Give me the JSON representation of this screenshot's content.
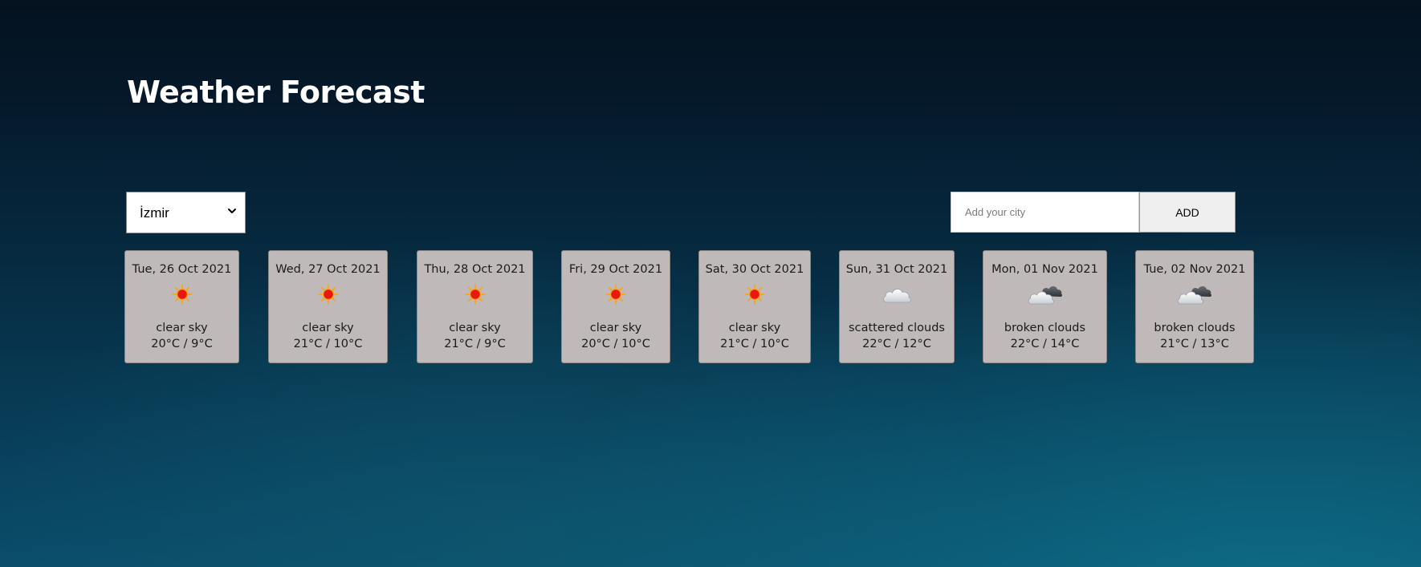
{
  "page": {
    "title": "Weather Forecast"
  },
  "city_select": {
    "selected": "İzmir",
    "icon": "chevron-down-icon"
  },
  "city_input": {
    "value": "",
    "placeholder": "Add your city"
  },
  "add_button": {
    "label": "ADD"
  },
  "forecast": [
    {
      "date": "Tue, 26 Oct 2021",
      "icon": "sun-icon",
      "description": "clear sky",
      "temp": "20°C / 9°C"
    },
    {
      "date": "Wed, 27 Oct 2021",
      "icon": "sun-icon",
      "description": "clear sky",
      "temp": "21°C / 10°C"
    },
    {
      "date": "Thu, 28 Oct 2021",
      "icon": "sun-icon",
      "description": "clear sky",
      "temp": "21°C / 9°C"
    },
    {
      "date": "Fri, 29 Oct 2021",
      "icon": "sun-icon",
      "description": "clear sky",
      "temp": "20°C / 10°C"
    },
    {
      "date": "Sat, 30 Oct 2021",
      "icon": "sun-icon",
      "description": "clear sky",
      "temp": "21°C / 10°C"
    },
    {
      "date": "Sun, 31 Oct 2021",
      "icon": "cloud-icon",
      "description": "scattered clouds",
      "temp": "22°C / 12°C"
    },
    {
      "date": "Mon, 01 Nov 2021",
      "icon": "broken-clouds-icon",
      "description": "broken clouds",
      "temp": "22°C / 14°C"
    },
    {
      "date": "Tue, 02 Nov 2021",
      "icon": "broken-clouds-icon",
      "description": "broken clouds",
      "temp": "21°C / 13°C"
    }
  ],
  "colors": {
    "card_background": "#bfb9b9",
    "title_text": "#ffffff",
    "sun_core": "#e8180c",
    "sun_rays": "#f5a623"
  }
}
